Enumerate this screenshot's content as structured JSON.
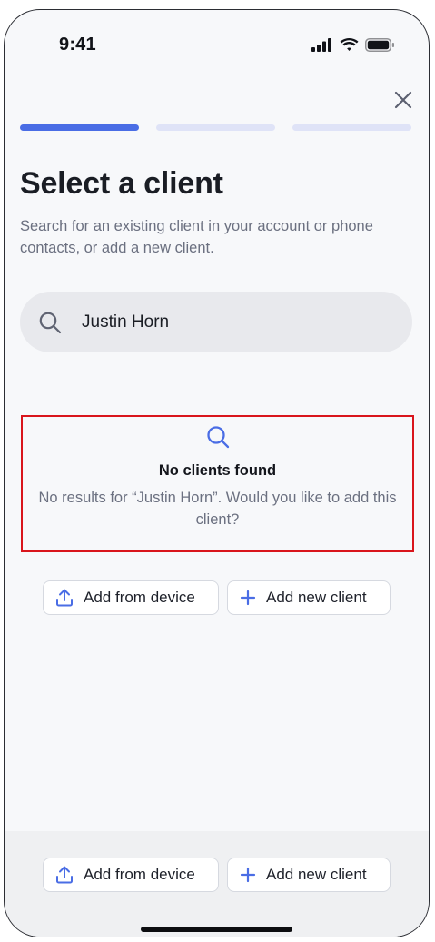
{
  "status_bar": {
    "time": "9:41"
  },
  "progress": {
    "steps": 3,
    "current": 1
  },
  "header": {
    "title": "Select a client",
    "subtitle": "Search for an existing client in your account or phone contacts, or add a new client."
  },
  "search": {
    "value": "Justin Horn"
  },
  "empty_state": {
    "title": "No clients found",
    "message": "No results for “Justin Horn”. Would you like to add this client?"
  },
  "actions": {
    "add_from_device": "Add from device",
    "add_new_client": "Add new client"
  },
  "footer_actions": {
    "add_from_device": "Add from device",
    "add_new_client": "Add new client"
  },
  "colors": {
    "accent": "#4a6de5",
    "highlight_border": "#d9151c",
    "background": "#f7f8fa"
  }
}
